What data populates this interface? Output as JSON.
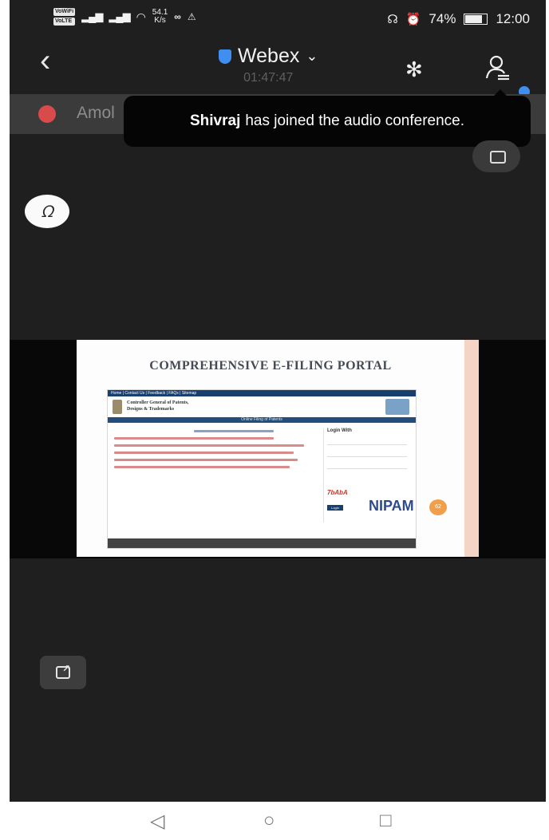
{
  "status_bar": {
    "volte1": "VoWiFi",
    "volte2": "VoLTE",
    "speed_value": "54.1",
    "speed_unit": "K/s",
    "battery": "74%",
    "time": "12:00"
  },
  "header": {
    "app_title": "Webex",
    "timer": "01:47:47"
  },
  "speaker_strip": {
    "name": "Amol"
  },
  "toast": {
    "name": "Shivraj",
    "message": "has joined the audio conference."
  },
  "shared_slide": {
    "title": "COMPREHENSIVE E-FILING PORTAL",
    "site_nav": "Home | Contact Us | Feedback | FAQs | Sitemap",
    "org_line1": "Controller General of Patents,",
    "org_line2": "Designs & Trademarks",
    "band": "Online Filing of Patents",
    "login_title": "Login With",
    "captcha": "7bAbA",
    "login_button": "Login",
    "watermark": "NIPAM",
    "badge": "62"
  },
  "colors": {
    "accent": "#3f8ef0",
    "background": "#1f1f1f",
    "toast": "#050505"
  }
}
